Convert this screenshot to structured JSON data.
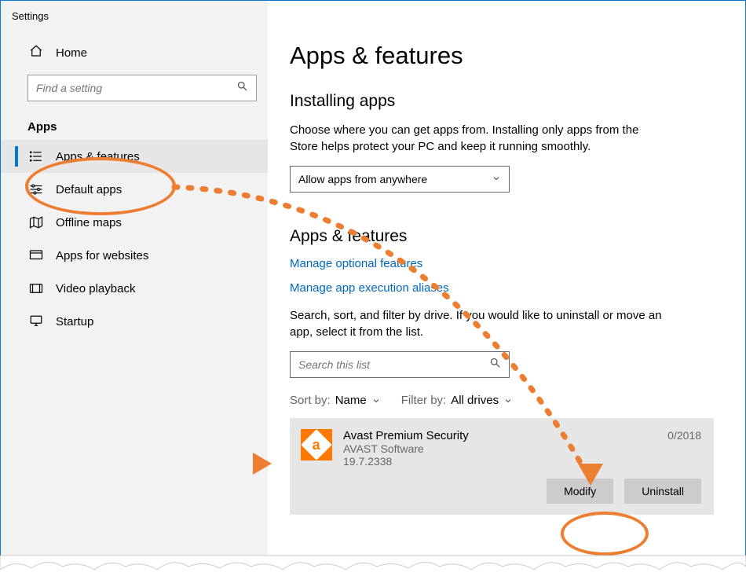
{
  "window": {
    "title": "Settings"
  },
  "sidebar": {
    "home": "Home",
    "search_placeholder": "Find a setting",
    "section": "Apps",
    "items": [
      {
        "label": "Apps & features"
      },
      {
        "label": "Default apps"
      },
      {
        "label": "Offline maps"
      },
      {
        "label": "Apps for websites"
      },
      {
        "label": "Video playback"
      },
      {
        "label": "Startup"
      }
    ]
  },
  "main": {
    "title": "Apps & features",
    "installing": {
      "heading": "Installing apps",
      "desc": "Choose where you can get apps from. Installing only apps from the Store helps protect your PC and keep it running smoothly.",
      "dropdown": "Allow apps from anywhere"
    },
    "apps": {
      "heading": "Apps & features",
      "link1": "Manage optional features",
      "link2": "Manage app execution aliases",
      "desc": "Search, sort, and filter by drive. If you would like to uninstall or move an app, select it from the list.",
      "search_placeholder": "Search this list",
      "sort_label": "Sort by:",
      "sort_value": "Name",
      "filter_label": "Filter by:",
      "filter_value": "All drives"
    },
    "app_card": {
      "name": "Avast Premium Security",
      "publisher": "AVAST Software",
      "version": "19.7.2338",
      "date": "0/2018",
      "modify": "Modify",
      "uninstall": "Uninstall"
    }
  }
}
